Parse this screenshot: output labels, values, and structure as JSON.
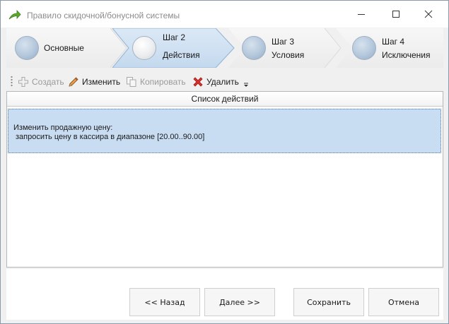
{
  "window": {
    "title": "Правило скидочной/бонусной системы",
    "icon": "green-arrow-icon"
  },
  "steps": [
    {
      "label": "Основные",
      "sub": "",
      "state": "done"
    },
    {
      "label": "Шаг 2",
      "sub": "Действия",
      "state": "current"
    },
    {
      "label": "Шаг 3",
      "sub": "Условия",
      "state": "pending"
    },
    {
      "label": "Шаг 4",
      "sub": "Исключения",
      "state": "pending"
    }
  ],
  "toolbar": {
    "create_label": "Создать",
    "edit_label": "Изменить",
    "copy_label": "Копировать",
    "delete_label": "Удалить"
  },
  "grid": {
    "header": "Список  действий",
    "rows": [
      {
        "line1": "Изменить продажную цену:",
        "line2": "запросить цену в кассира в диапазоне [20.00..90.00]"
      }
    ]
  },
  "buttons": {
    "back": "<< Назад",
    "next": "Далее >>",
    "save": "Сохранить",
    "cancel": "Отмена"
  },
  "colors": {
    "selection": "#c9ddf2",
    "current_step": "#cde0f3",
    "delete_icon": "#d9302c",
    "app_icon": "#5aa82e"
  }
}
